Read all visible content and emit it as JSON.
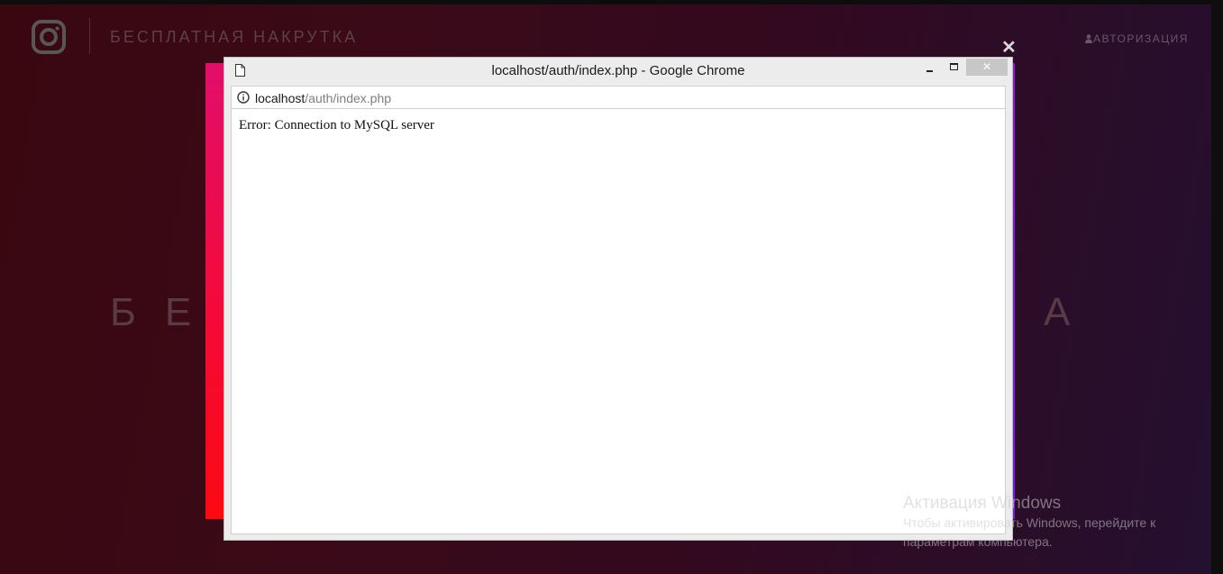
{
  "site": {
    "title": "БЕСПЛАТНАЯ НАКРУТКА",
    "auth_label": "АВТОРИЗАЦИЯ",
    "hero_left": "БЕ",
    "hero_right": "А",
    "logo_icon": "instagram-icon"
  },
  "modal": {
    "close_label": "✕"
  },
  "popup": {
    "window_title": "localhost/auth/index.php - Google Chrome",
    "close_glyph": "✕",
    "url_host": "localhost",
    "url_path": "/auth/index.php",
    "error_message": "Error: Connection to MySQL server"
  },
  "watermark": {
    "title": "Активация Windows",
    "line1": "Чтобы активировать Windows, перейдите к",
    "line2": "параметрам компьютера."
  },
  "colors": {
    "frame_gradient_top": "#e10e6a",
    "frame_gradient_bottom": "#fb0a12",
    "frame_right": "#8d1ad8",
    "background": "#3a0710"
  }
}
